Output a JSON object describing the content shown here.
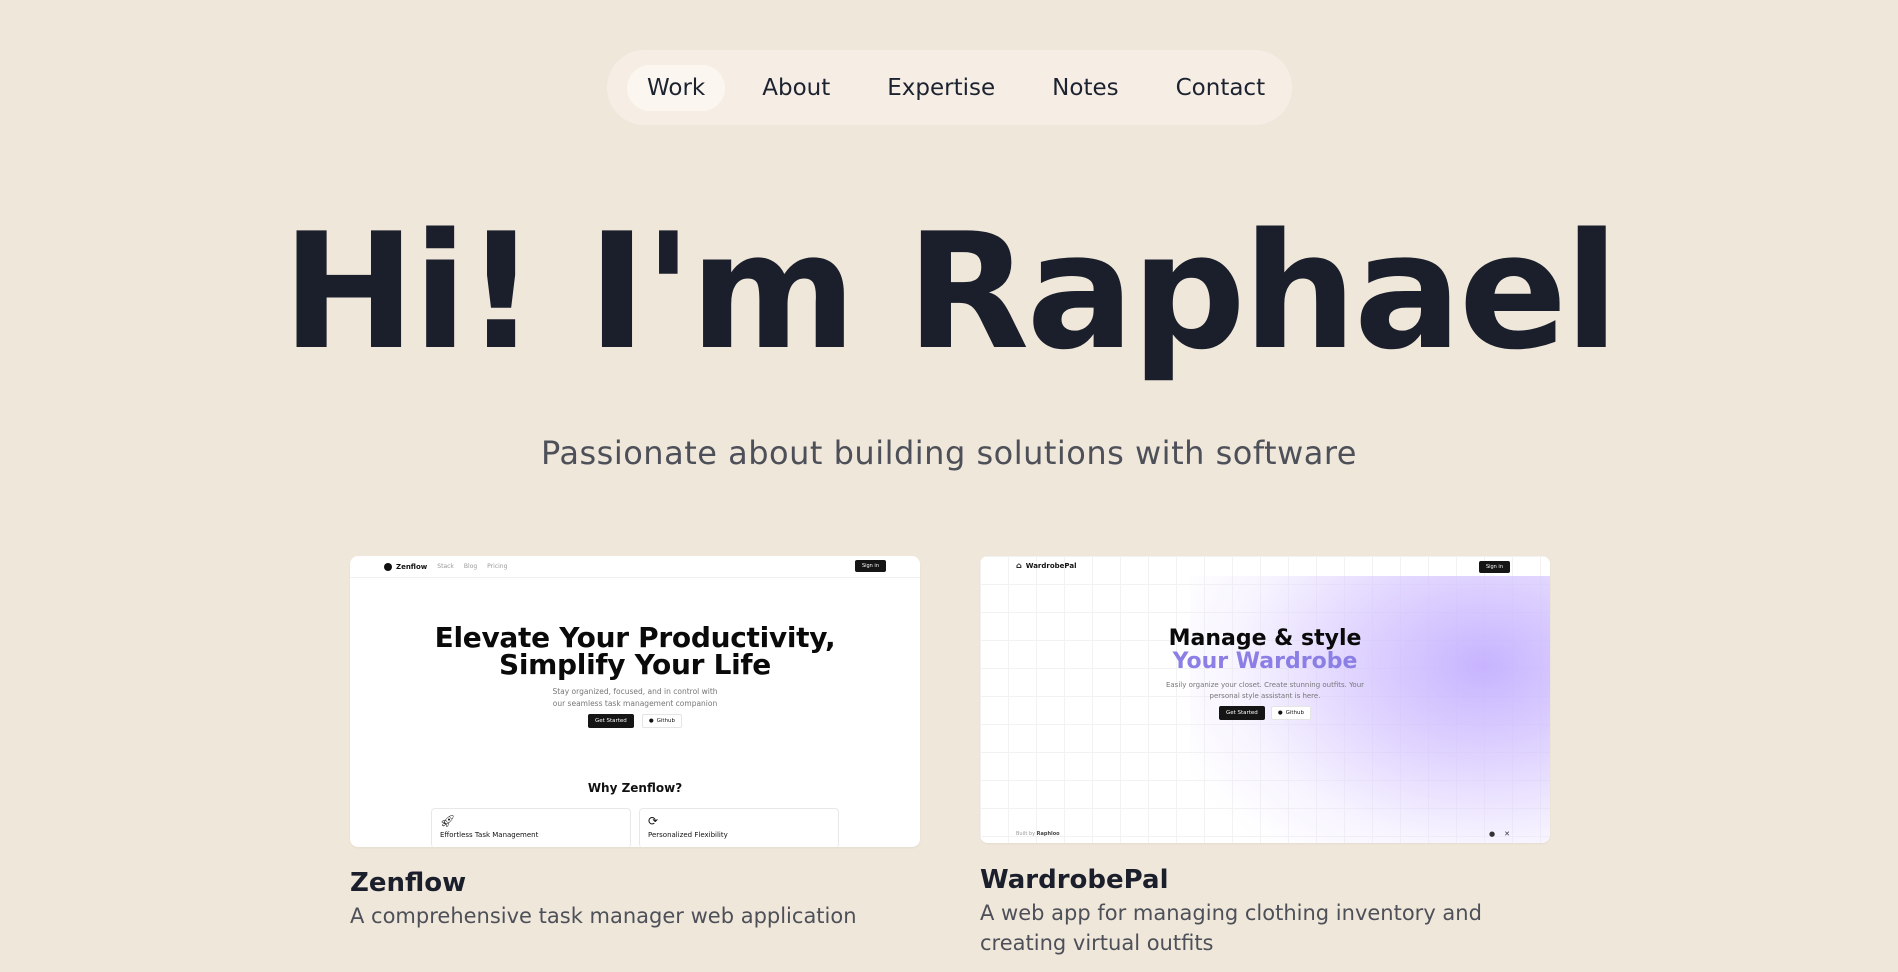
{
  "nav": {
    "items": [
      "Work",
      "About",
      "Expertise",
      "Notes",
      "Contact"
    ],
    "active": "Work"
  },
  "hero": {
    "title": "Hi! I'm Raphael",
    "subtitle": "Passionate about building solutions with software"
  },
  "projects": [
    {
      "title": "Zenflow",
      "description": "A comprehensive task manager web application",
      "preview": {
        "brand": "Zenflow",
        "links": [
          "Stack",
          "Blog",
          "Pricing"
        ],
        "signin": "Sign in",
        "headline_line1": "Elevate Your Productivity,",
        "headline_line2": "Simplify Your Life",
        "sub_line1": "Stay organized, focused, and in control with",
        "sub_line2": "our seamless task management companion",
        "cta_primary": "Get Started",
        "cta_secondary": "Github",
        "section_title": "Why Zenflow?",
        "features": [
          "Effortless Task Management",
          "Personalized Flexibility"
        ]
      }
    },
    {
      "title": "WardrobePal",
      "description": "A web app for managing clothing inventory and creating virtual outfits",
      "preview": {
        "brand": "WardrobePal",
        "signin": "Sign in",
        "headline_line1": "Manage & style",
        "headline_line2": "Your Wardrobe",
        "sub_line1": "Easily organize your closet. Create stunning outfits. Your",
        "sub_line2": "personal style assistant is here.",
        "cta_primary": "Get Started",
        "cta_secondary": "Github",
        "footer_prefix": "Built by",
        "footer_author": "Raphloo"
      }
    }
  ],
  "colors": {
    "background": "#f0e7db",
    "nav_bg": "#f6eee4",
    "text_dark": "#1a1f2b",
    "text_muted": "#4d5058",
    "accent_purple": "#8b7fe6"
  }
}
